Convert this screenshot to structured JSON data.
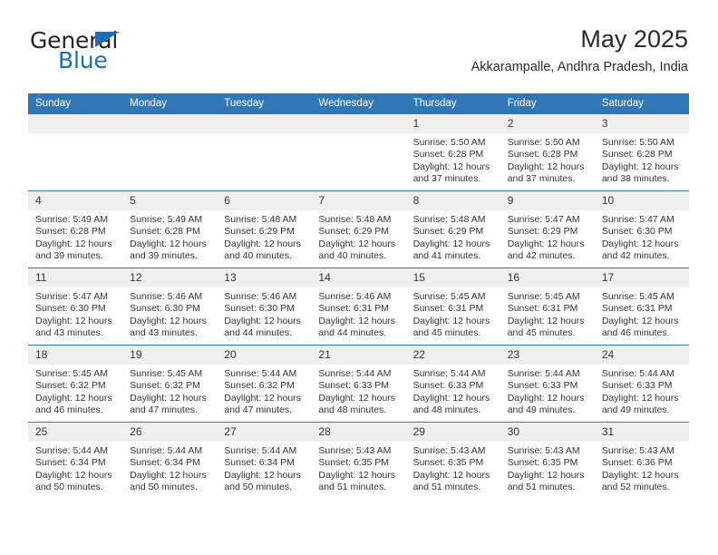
{
  "brand": {
    "name_top": "General",
    "name_bottom": "Blue",
    "triangle_icon": "brand-triangle-icon",
    "accent_color": "#1a6fba"
  },
  "header": {
    "title": "May 2025",
    "subtitle": "Akkarampalle, Andhra Pradesh, India"
  },
  "theme": {
    "header_blue": "#3077b7",
    "daynum_band": "#efefef",
    "text": "#333333"
  },
  "calendar": {
    "weekday_headers": [
      "Sunday",
      "Monday",
      "Tuesday",
      "Wednesday",
      "Thursday",
      "Friday",
      "Saturday"
    ],
    "weeks": [
      [
        {
          "day": "",
          "sunrise": "",
          "sunset": "",
          "daylight": ""
        },
        {
          "day": "",
          "sunrise": "",
          "sunset": "",
          "daylight": ""
        },
        {
          "day": "",
          "sunrise": "",
          "sunset": "",
          "daylight": ""
        },
        {
          "day": "",
          "sunrise": "",
          "sunset": "",
          "daylight": ""
        },
        {
          "day": "1",
          "sunrise": "Sunrise: 5:50 AM",
          "sunset": "Sunset: 6:28 PM",
          "daylight": "Daylight: 12 hours and 37 minutes."
        },
        {
          "day": "2",
          "sunrise": "Sunrise: 5:50 AM",
          "sunset": "Sunset: 6:28 PM",
          "daylight": "Daylight: 12 hours and 37 minutes."
        },
        {
          "day": "3",
          "sunrise": "Sunrise: 5:50 AM",
          "sunset": "Sunset: 6:28 PM",
          "daylight": "Daylight: 12 hours and 38 minutes."
        }
      ],
      [
        {
          "day": "4",
          "sunrise": "Sunrise: 5:49 AM",
          "sunset": "Sunset: 6:28 PM",
          "daylight": "Daylight: 12 hours and 39 minutes."
        },
        {
          "day": "5",
          "sunrise": "Sunrise: 5:49 AM",
          "sunset": "Sunset: 6:28 PM",
          "daylight": "Daylight: 12 hours and 39 minutes."
        },
        {
          "day": "6",
          "sunrise": "Sunrise: 5:48 AM",
          "sunset": "Sunset: 6:29 PM",
          "daylight": "Daylight: 12 hours and 40 minutes."
        },
        {
          "day": "7",
          "sunrise": "Sunrise: 5:48 AM",
          "sunset": "Sunset: 6:29 PM",
          "daylight": "Daylight: 12 hours and 40 minutes."
        },
        {
          "day": "8",
          "sunrise": "Sunrise: 5:48 AM",
          "sunset": "Sunset: 6:29 PM",
          "daylight": "Daylight: 12 hours and 41 minutes."
        },
        {
          "day": "9",
          "sunrise": "Sunrise: 5:47 AM",
          "sunset": "Sunset: 6:29 PM",
          "daylight": "Daylight: 12 hours and 42 minutes."
        },
        {
          "day": "10",
          "sunrise": "Sunrise: 5:47 AM",
          "sunset": "Sunset: 6:30 PM",
          "daylight": "Daylight: 12 hours and 42 minutes."
        }
      ],
      [
        {
          "day": "11",
          "sunrise": "Sunrise: 5:47 AM",
          "sunset": "Sunset: 6:30 PM",
          "daylight": "Daylight: 12 hours and 43 minutes."
        },
        {
          "day": "12",
          "sunrise": "Sunrise: 5:46 AM",
          "sunset": "Sunset: 6:30 PM",
          "daylight": "Daylight: 12 hours and 43 minutes."
        },
        {
          "day": "13",
          "sunrise": "Sunrise: 5:46 AM",
          "sunset": "Sunset: 6:30 PM",
          "daylight": "Daylight: 12 hours and 44 minutes."
        },
        {
          "day": "14",
          "sunrise": "Sunrise: 5:46 AM",
          "sunset": "Sunset: 6:31 PM",
          "daylight": "Daylight: 12 hours and 44 minutes."
        },
        {
          "day": "15",
          "sunrise": "Sunrise: 5:45 AM",
          "sunset": "Sunset: 6:31 PM",
          "daylight": "Daylight: 12 hours and 45 minutes."
        },
        {
          "day": "16",
          "sunrise": "Sunrise: 5:45 AM",
          "sunset": "Sunset: 6:31 PM",
          "daylight": "Daylight: 12 hours and 45 minutes."
        },
        {
          "day": "17",
          "sunrise": "Sunrise: 5:45 AM",
          "sunset": "Sunset: 6:31 PM",
          "daylight": "Daylight: 12 hours and 46 minutes."
        }
      ],
      [
        {
          "day": "18",
          "sunrise": "Sunrise: 5:45 AM",
          "sunset": "Sunset: 6:32 PM",
          "daylight": "Daylight: 12 hours and 46 minutes."
        },
        {
          "day": "19",
          "sunrise": "Sunrise: 5:45 AM",
          "sunset": "Sunset: 6:32 PM",
          "daylight": "Daylight: 12 hours and 47 minutes."
        },
        {
          "day": "20",
          "sunrise": "Sunrise: 5:44 AM",
          "sunset": "Sunset: 6:32 PM",
          "daylight": "Daylight: 12 hours and 47 minutes."
        },
        {
          "day": "21",
          "sunrise": "Sunrise: 5:44 AM",
          "sunset": "Sunset: 6:33 PM",
          "daylight": "Daylight: 12 hours and 48 minutes."
        },
        {
          "day": "22",
          "sunrise": "Sunrise: 5:44 AM",
          "sunset": "Sunset: 6:33 PM",
          "daylight": "Daylight: 12 hours and 48 minutes."
        },
        {
          "day": "23",
          "sunrise": "Sunrise: 5:44 AM",
          "sunset": "Sunset: 6:33 PM",
          "daylight": "Daylight: 12 hours and 49 minutes."
        },
        {
          "day": "24",
          "sunrise": "Sunrise: 5:44 AM",
          "sunset": "Sunset: 6:33 PM",
          "daylight": "Daylight: 12 hours and 49 minutes."
        }
      ],
      [
        {
          "day": "25",
          "sunrise": "Sunrise: 5:44 AM",
          "sunset": "Sunset: 6:34 PM",
          "daylight": "Daylight: 12 hours and 50 minutes."
        },
        {
          "day": "26",
          "sunrise": "Sunrise: 5:44 AM",
          "sunset": "Sunset: 6:34 PM",
          "daylight": "Daylight: 12 hours and 50 minutes."
        },
        {
          "day": "27",
          "sunrise": "Sunrise: 5:44 AM",
          "sunset": "Sunset: 6:34 PM",
          "daylight": "Daylight: 12 hours and 50 minutes."
        },
        {
          "day": "28",
          "sunrise": "Sunrise: 5:43 AM",
          "sunset": "Sunset: 6:35 PM",
          "daylight": "Daylight: 12 hours and 51 minutes."
        },
        {
          "day": "29",
          "sunrise": "Sunrise: 5:43 AM",
          "sunset": "Sunset: 6:35 PM",
          "daylight": "Daylight: 12 hours and 51 minutes."
        },
        {
          "day": "30",
          "sunrise": "Sunrise: 5:43 AM",
          "sunset": "Sunset: 6:35 PM",
          "daylight": "Daylight: 12 hours and 51 minutes."
        },
        {
          "day": "31",
          "sunrise": "Sunrise: 5:43 AM",
          "sunset": "Sunset: 6:36 PM",
          "daylight": "Daylight: 12 hours and 52 minutes."
        }
      ]
    ]
  }
}
